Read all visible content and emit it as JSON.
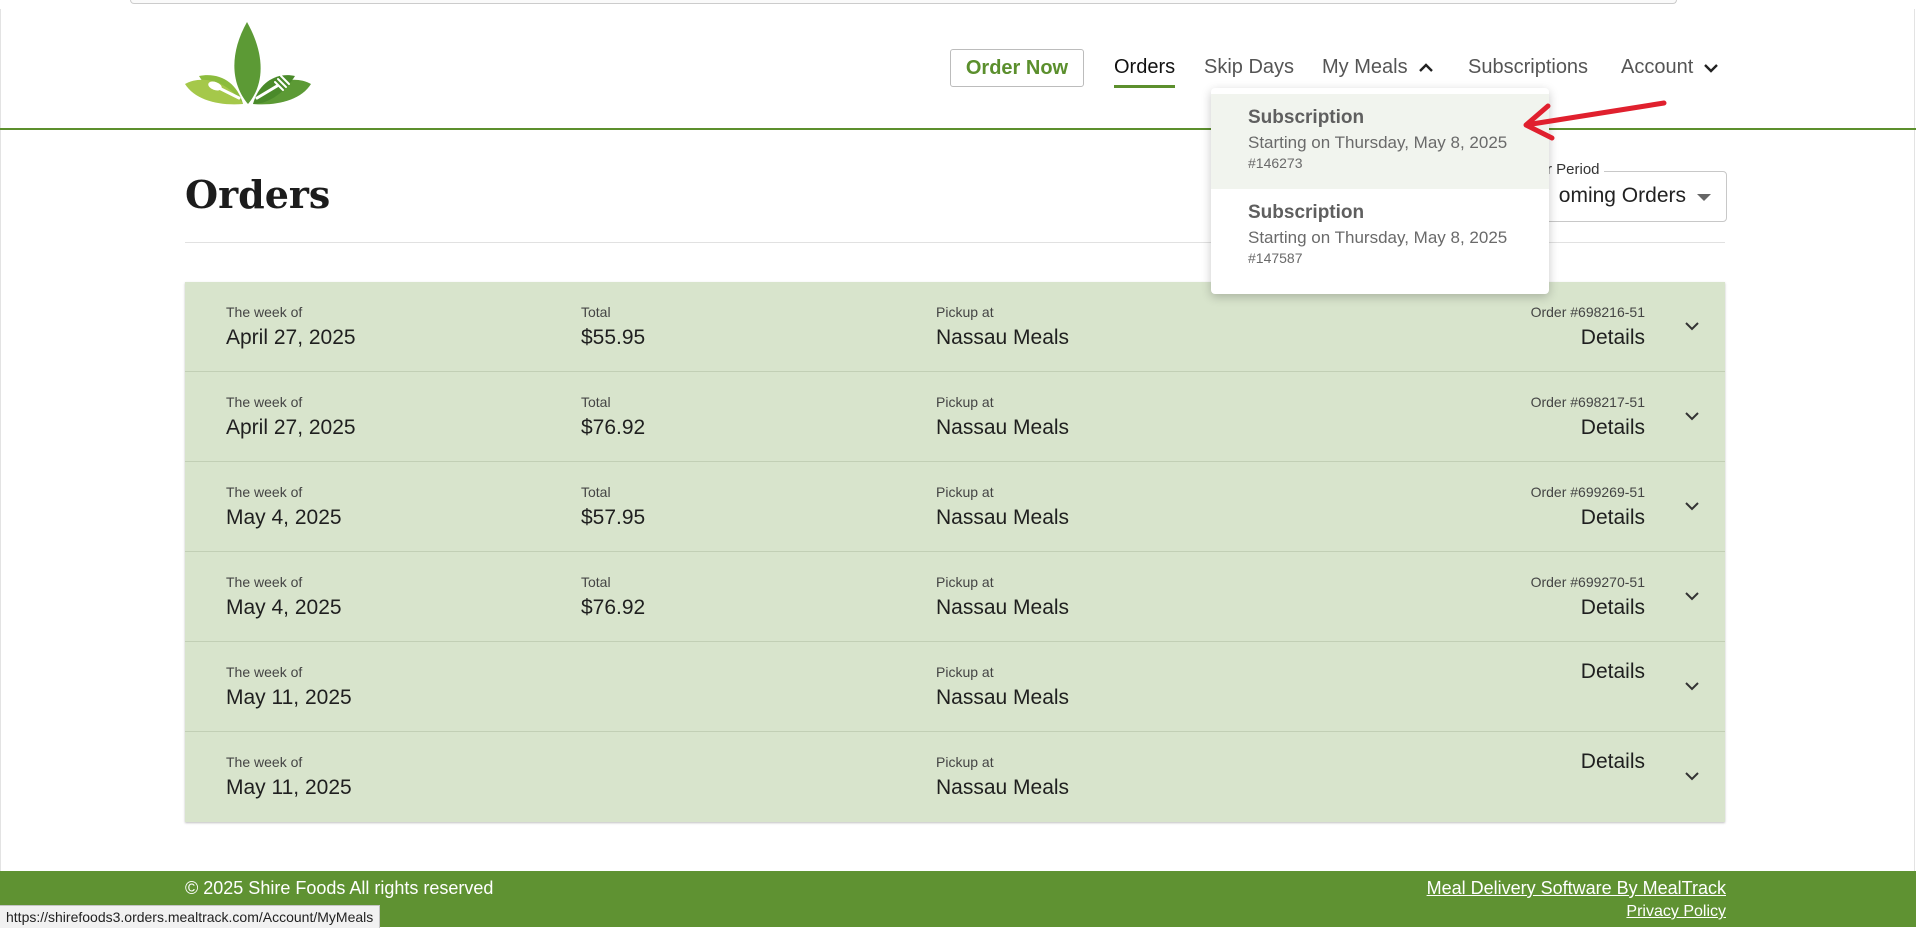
{
  "header": {
    "order_now": "Order Now",
    "nav": {
      "orders": "Orders",
      "skip_days": "Skip Days",
      "my_meals": "My Meals",
      "subscriptions": "Subscriptions",
      "account": "Account"
    }
  },
  "my_meals_dropdown": [
    {
      "title": "Subscription",
      "subtitle": "Starting on Thursday, May 8, 2025",
      "number": "#146273"
    },
    {
      "title": "Subscription",
      "subtitle": "Starting on Thursday, May 8, 2025",
      "number": "#147587"
    }
  ],
  "page": {
    "title": "Orders",
    "period_label": "r Period",
    "period_value": "oming Orders"
  },
  "orders": [
    {
      "week_label": "The week of",
      "week": "April 27, 2025",
      "total_label": "Total",
      "total": "$55.95",
      "pickup_label": "Pickup at",
      "pickup": "Nassau Meals",
      "order_no": "Order #698216-51",
      "details": "Details"
    },
    {
      "week_label": "The week of",
      "week": "April 27, 2025",
      "total_label": "Total",
      "total": "$76.92",
      "pickup_label": "Pickup at",
      "pickup": "Nassau Meals",
      "order_no": "Order #698217-51",
      "details": "Details"
    },
    {
      "week_label": "The week of",
      "week": "May 4, 2025",
      "total_label": "Total",
      "total": "$57.95",
      "pickup_label": "Pickup at",
      "pickup": "Nassau Meals",
      "order_no": "Order #699269-51",
      "details": "Details"
    },
    {
      "week_label": "The week of",
      "week": "May 4, 2025",
      "total_label": "Total",
      "total": "$76.92",
      "pickup_label": "Pickup at",
      "pickup": "Nassau Meals",
      "order_no": "Order #699270-51",
      "details": "Details"
    },
    {
      "week_label": "The week of",
      "week": "May 11, 2025",
      "total_label": "",
      "total": "",
      "pickup_label": "Pickup at",
      "pickup": "Nassau Meals",
      "order_no": "",
      "details": "Details"
    },
    {
      "week_label": "The week of",
      "week": "May 11, 2025",
      "total_label": "",
      "total": "",
      "pickup_label": "Pickup at",
      "pickup": "Nassau Meals",
      "order_no": "",
      "details": "Details"
    }
  ],
  "footer": {
    "copyright": "© 2025 Shire Foods All rights reserved",
    "software_link": "Meal Delivery Software By MealTrack",
    "privacy_link": "Privacy Policy"
  },
  "status_url": "https://shirefoods3.orders.mealtrack.com/Account/MyMeals",
  "colors": {
    "brand_green": "#5f9232",
    "row_bg": "#d8e4cc",
    "annotation_red": "#e0202e"
  }
}
